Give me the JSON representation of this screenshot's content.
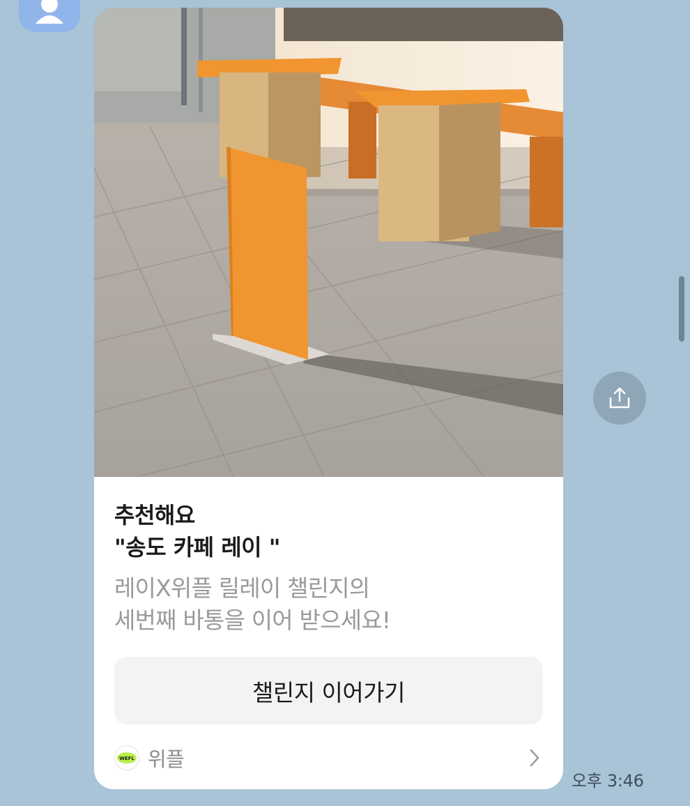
{
  "chat": {
    "message_card": {
      "headline_line1": "추천해요",
      "headline_line2": "\"송도 카페 레이 \"",
      "description_line1": "레이X위플 릴레이 챌린지의",
      "description_line2": "세번째 바통을 이어 받으세요!",
      "cta_label": "챌린지 이어가기",
      "brand_logo_text": "WEFL",
      "brand_name": "위플"
    },
    "timestamp": "오후 3:46"
  },
  "colors": {
    "chat_background": "#a9c3d7",
    "card_background": "#ffffff",
    "cta_background": "#f3f3f5",
    "share_button": "#8fa6b6",
    "sign_orange": "#f0952f"
  },
  "icons": {
    "avatar": "person-silhouette-icon",
    "share": "share-upload-icon",
    "footer_chevron": "chevron-right-icon"
  }
}
